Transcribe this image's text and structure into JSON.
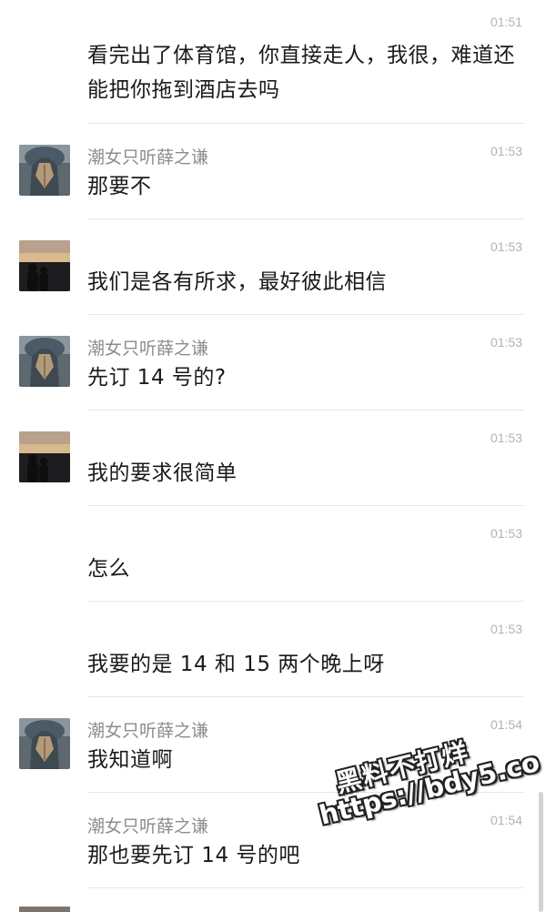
{
  "chat": {
    "messages": [
      {
        "time": "01:51",
        "sender": "",
        "text": "看完出了体育馆，你直接走人，我很，难道还能把你拖到酒店去吗",
        "avatar": "none"
      },
      {
        "time": "01:53",
        "sender": "潮女只听薛之谦",
        "text": "那要不",
        "avatar": "girl-avatar"
      },
      {
        "time": "01:53",
        "sender": "",
        "text": "我们是各有所求，最好彼此相信",
        "avatar": "sunset-avatar"
      },
      {
        "time": "01:53",
        "sender": "潮女只听薛之谦",
        "text": "先订 14 号的?",
        "avatar": "girl-avatar"
      },
      {
        "time": "01:53",
        "sender": "",
        "text": "我的要求很简单",
        "avatar": "sunset-avatar"
      },
      {
        "time": "01:53",
        "sender": "",
        "text": "怎么",
        "avatar": "none"
      },
      {
        "time": "01:53",
        "sender": "",
        "text": "我要的是 14 和 15 两个晚上呀",
        "avatar": "none"
      },
      {
        "time": "01:54",
        "sender": "潮女只听薛之谦",
        "text": "我知道啊",
        "avatar": "girl-avatar"
      },
      {
        "time": "01:54",
        "sender": "潮女只听薛之谦",
        "text": "那也要先订 14 号的吧",
        "avatar": "none"
      }
    ]
  },
  "watermark": {
    "line1": "黑料不打烊",
    "line2": "https://bdy5.co"
  },
  "colors": {
    "text": "#1a1a1a",
    "sender": "#8c8c8c",
    "time": "#b3b3b3",
    "divider": "#e8e8e8"
  }
}
